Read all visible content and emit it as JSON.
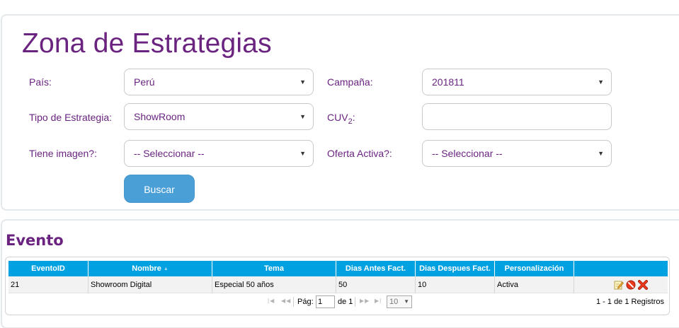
{
  "page": {
    "title": "Zona de Estrategias"
  },
  "filters": {
    "pais": {
      "label": "País:",
      "value": "Perú"
    },
    "campania": {
      "label": "Campaña:",
      "value": "201811"
    },
    "tipo_estrategia": {
      "label": "Tipo de Estrategia:",
      "value": "ShowRoom"
    },
    "cuv2": {
      "label": "CUV",
      "label_sub": "2",
      "label_suffix": ":",
      "value": ""
    },
    "tiene_imagen": {
      "label": "Tiene imagen?:",
      "value": "-- Seleccionar --"
    },
    "oferta_activa": {
      "label": "Oferta Activa?:",
      "value": "-- Seleccionar --"
    },
    "buscar_label": "Buscar"
  },
  "evento": {
    "title": "Evento",
    "columns": [
      "EventoID",
      "Nombre",
      "Tema",
      "Dias Antes Fact.",
      "Dias Despues Fact.",
      "Personalización",
      ""
    ],
    "rows": [
      {
        "eventoid": "21",
        "nombre": "Showroom Digital",
        "tema": "Especial 50 años",
        "dias_antes": "50",
        "dias_despues": "10",
        "personalizacion": "Activa"
      }
    ],
    "row_actions": [
      "edit-icon",
      "disable-icon",
      "delete-icon"
    ],
    "pager": {
      "pag_label": "Pág:",
      "page": "1",
      "of_label": "de 1",
      "page_size": "10",
      "records": "1 - 1 de 1 Registros"
    }
  },
  "colors": {
    "brand_purple": "#6a2480",
    "button_blue": "#4a9fd6",
    "grid_header": "#00a1e0"
  }
}
